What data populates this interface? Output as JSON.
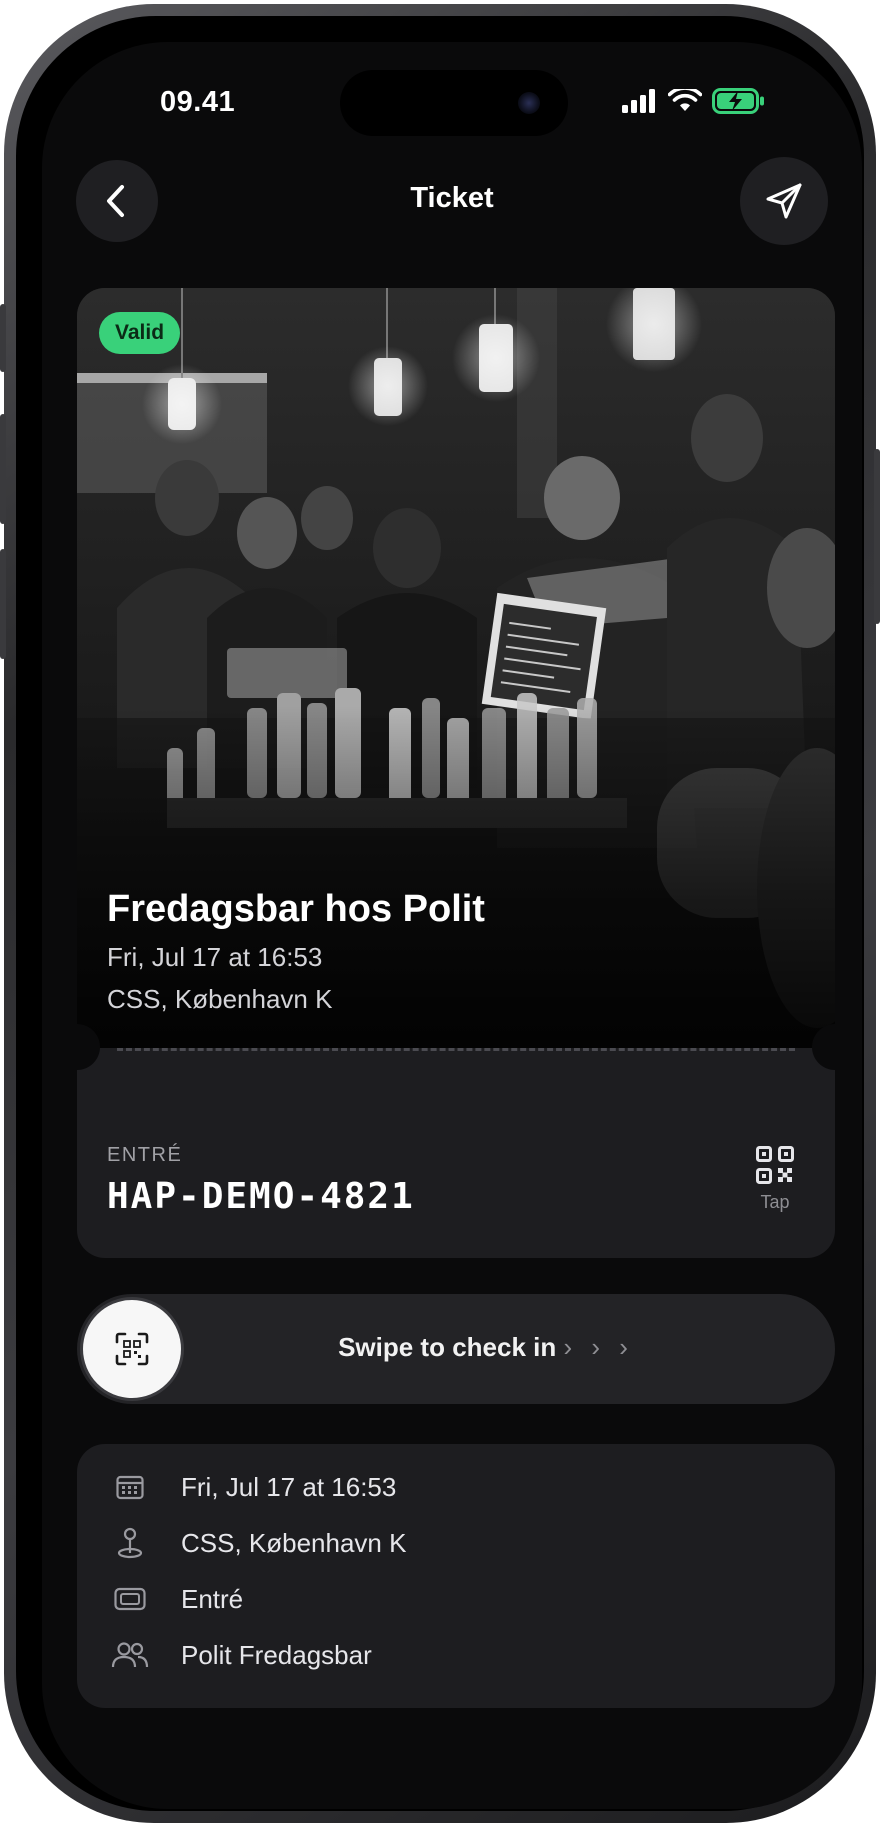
{
  "status_bar": {
    "time": "09.41"
  },
  "nav": {
    "title": "Ticket",
    "back_icon": "chevron-left-icon",
    "share_icon": "paper-plane-icon"
  },
  "ticket": {
    "badge": "Valid",
    "badge_color": "#39d17a",
    "event_title": "Fredagsbar hos Polit",
    "event_datetime": "Fri, Jul 17 at 16:53",
    "event_location": "CSS, København K",
    "entry_label": "ENTRÉ",
    "entry_code": "HAP-DEMO-4821",
    "qr_label": "Tap"
  },
  "swipe": {
    "label": "Swipe to check in",
    "chevrons": "› › ›",
    "icon": "qr-scan-icon"
  },
  "details": [
    {
      "icon": "calendar-icon",
      "text": "Fri, Jul 17 at 16:53"
    },
    {
      "icon": "location-pin-icon",
      "text": "CSS, København K"
    },
    {
      "icon": "ticket-icon",
      "text": "Entré"
    },
    {
      "icon": "people-icon",
      "text": "Polit Fredagsbar"
    }
  ]
}
